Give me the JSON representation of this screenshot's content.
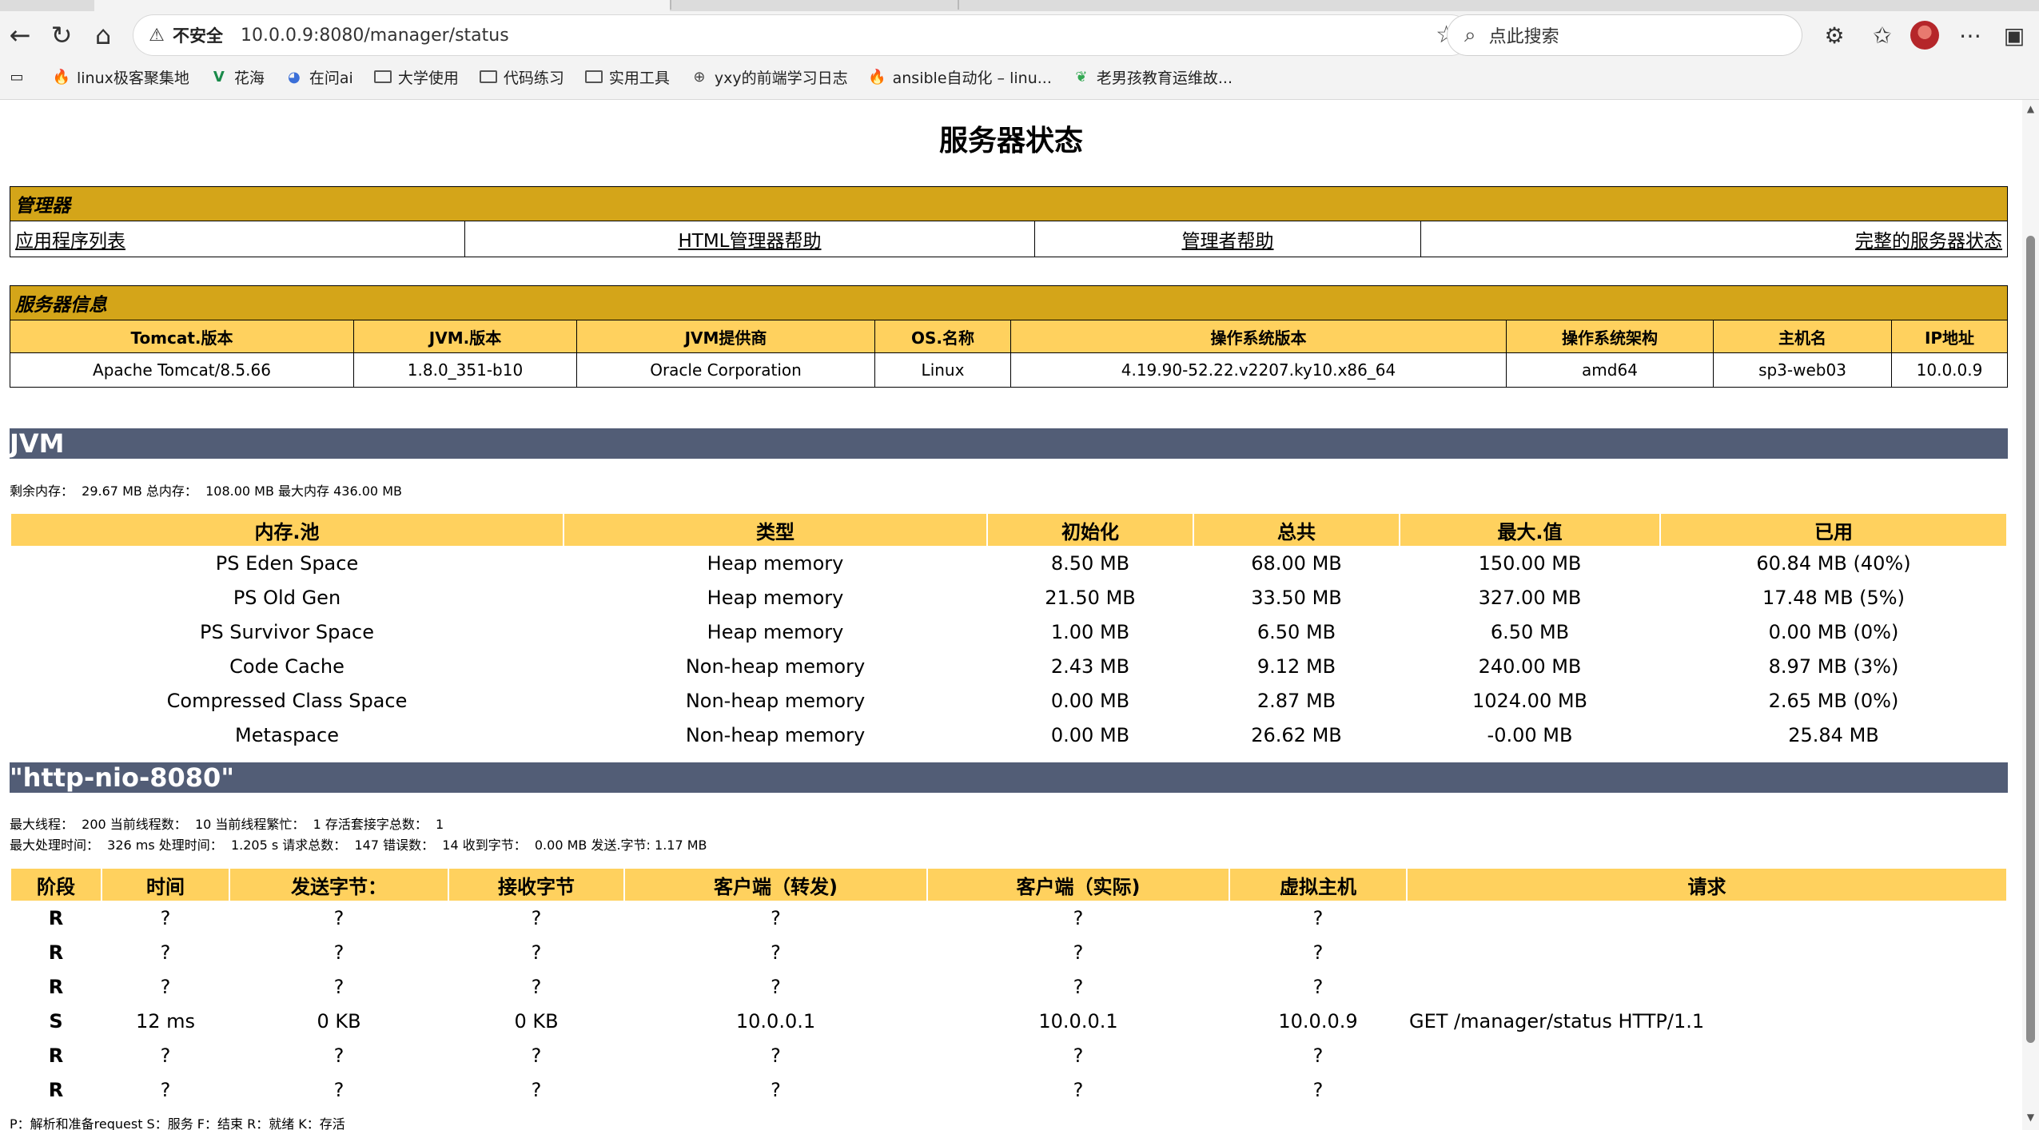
{
  "browser": {
    "address": {
      "insecure_label": "不安全",
      "url": "10.0.0.9:8080/manager/status"
    },
    "search": {
      "placeholder": "点此搜索"
    },
    "bookmarks": [
      {
        "icon": "fire-icon",
        "label": "linux极客聚集地"
      },
      {
        "icon": "v-logo-icon",
        "label": "花海"
      },
      {
        "icon": "ai-logo-icon",
        "label": "在问ai"
      },
      {
        "icon": "folder-icon",
        "label": "大学使用"
      },
      {
        "icon": "folder-icon",
        "label": "代码练习"
      },
      {
        "icon": "folder-icon",
        "label": "实用工具"
      },
      {
        "icon": "globe-icon",
        "label": "yxy的前端学习日志"
      },
      {
        "icon": "fire-icon",
        "label": "ansible自动化 – linu..."
      },
      {
        "icon": "leaf-icon",
        "label": "老男孩教育运维故..."
      }
    ]
  },
  "page": {
    "title": "服务器状态",
    "manager": {
      "title": "管理器",
      "links": [
        "应用程序列表",
        "HTML管理器帮助",
        "管理者帮助",
        "完整的服务器状态"
      ]
    },
    "server_info": {
      "title": "服务器信息",
      "headers": [
        "Tomcat.版本",
        "JVM.版本",
        "JVM提供商",
        "OS.名称",
        "操作系统版本",
        "操作系统架构",
        "主机名",
        "IP地址"
      ],
      "values": [
        "Apache Tomcat/8.5.66",
        "1.8.0_351-b10",
        "Oracle Corporation",
        "Linux",
        "4.19.90-52.22.v2207.ky10.x86_64",
        "amd64",
        "sp3-web03",
        "10.0.0.9"
      ]
    },
    "jvm": {
      "title": "JVM",
      "summary": "剩余内存：  29.67 MB 总内存：  108.00 MB 最大内存 436.00 MB",
      "headers": [
        "内存.池",
        "类型",
        "初始化",
        "总共",
        "最大.值",
        "已用"
      ],
      "rows": [
        [
          "PS Eden Space",
          "Heap memory",
          "8.50 MB",
          "68.00 MB",
          "150.00 MB",
          "60.84 MB (40%)"
        ],
        [
          "PS Old Gen",
          "Heap memory",
          "21.50 MB",
          "33.50 MB",
          "327.00 MB",
          "17.48 MB (5%)"
        ],
        [
          "PS Survivor Space",
          "Heap memory",
          "1.00 MB",
          "6.50 MB",
          "6.50 MB",
          "0.00 MB (0%)"
        ],
        [
          "Code Cache",
          "Non-heap memory",
          "2.43 MB",
          "9.12 MB",
          "240.00 MB",
          "8.97 MB (3%)"
        ],
        [
          "Compressed Class Space",
          "Non-heap memory",
          "0.00 MB",
          "2.87 MB",
          "1024.00 MB",
          "2.65 MB (0%)"
        ],
        [
          "Metaspace",
          "Non-heap memory",
          "0.00 MB",
          "26.62 MB",
          "-0.00 MB",
          "25.84 MB"
        ]
      ]
    },
    "connector": {
      "title": "\"http-nio-8080\"",
      "line1": "最大线程：  200 当前线程数：  10 当前线程繁忙：  1 存活套接字总数：  1",
      "line2": "最大处理时间：  326 ms 处理时间：  1.205 s 请求总数：  147 错误数：  14 收到字节：  0.00 MB 发送.字节: 1.17 MB",
      "headers": [
        "阶段",
        "时间",
        "发送字节：",
        "接收字节",
        "客户端（转发)",
        "客户端（实际)",
        "虚拟主机",
        "请求"
      ],
      "rows": [
        [
          "R",
          "?",
          "?",
          "?",
          "?",
          "?",
          "?",
          ""
        ],
        [
          "R",
          "?",
          "?",
          "?",
          "?",
          "?",
          "?",
          ""
        ],
        [
          "R",
          "?",
          "?",
          "?",
          "?",
          "?",
          "?",
          ""
        ],
        [
          "S",
          "12 ms",
          "0 KB",
          "0 KB",
          "10.0.0.1",
          "10.0.0.1",
          "10.0.0.9",
          "GET /manager/status HTTP/1.1"
        ],
        [
          "R",
          "?",
          "?",
          "?",
          "?",
          "?",
          "?",
          ""
        ],
        [
          "R",
          "?",
          "?",
          "?",
          "?",
          "?",
          "?",
          ""
        ]
      ],
      "legend": "P：解析和准备request S：服务 F：结束 R：就绪 K：存活"
    }
  },
  "colors": {
    "section_gold": "#d4a519",
    "header_yellow": "#ffd15e",
    "band_slate": "#525d76"
  }
}
